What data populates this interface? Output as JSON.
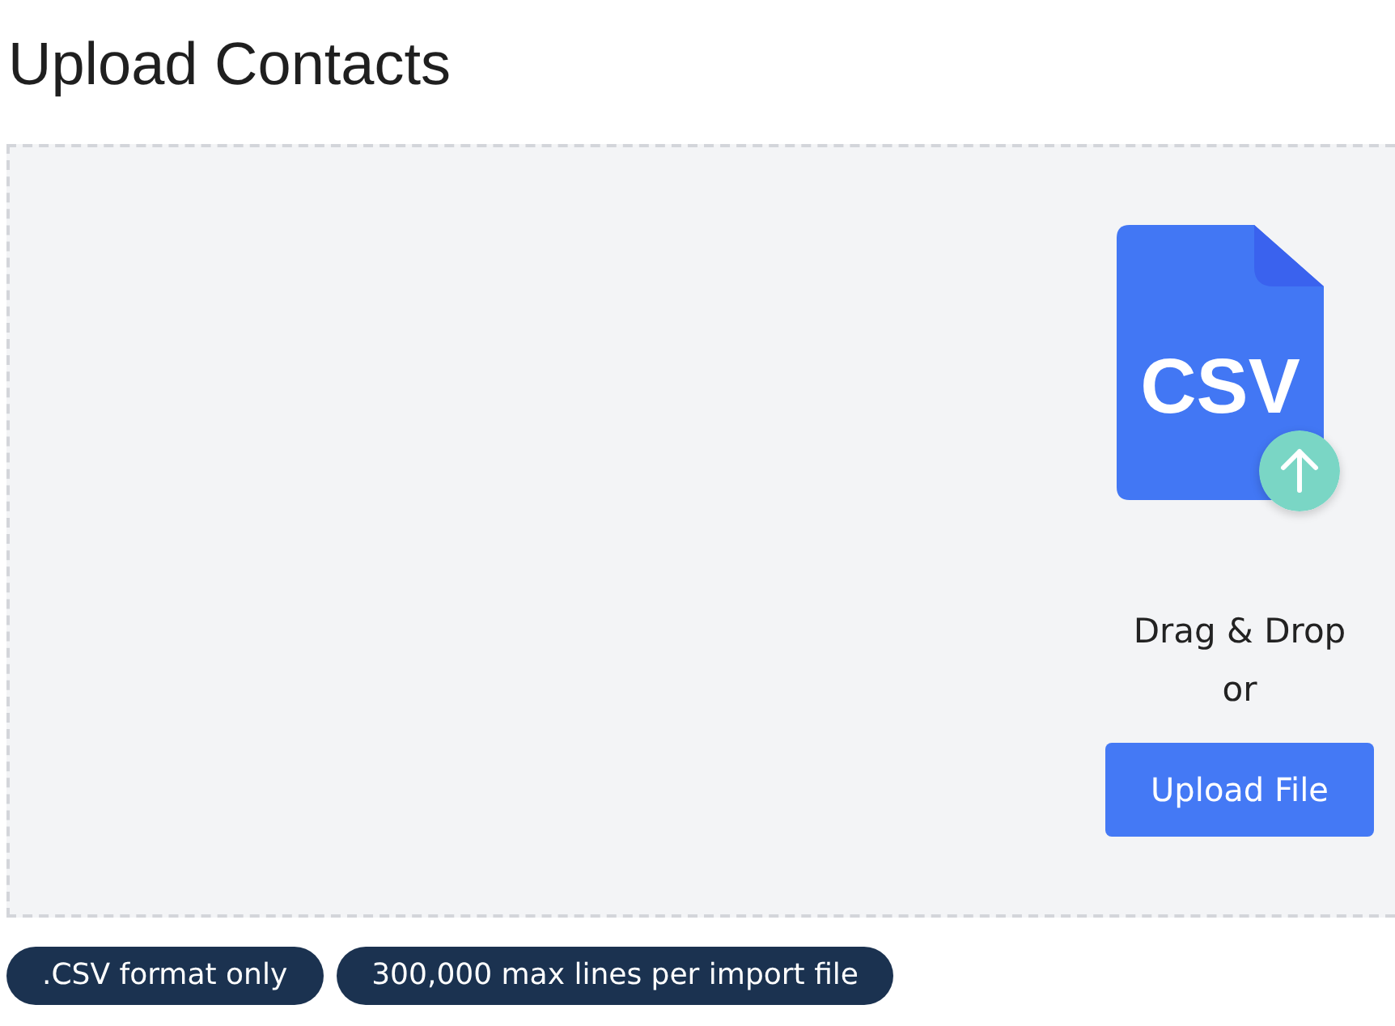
{
  "page": {
    "title": "Upload Contacts"
  },
  "dropzone": {
    "file_icon_label": "CSV",
    "prompt": "Drag & Drop",
    "separator": "or",
    "button": "Upload File"
  },
  "badges": [
    ".CSV format only",
    "300,000 max lines per import file"
  ]
}
